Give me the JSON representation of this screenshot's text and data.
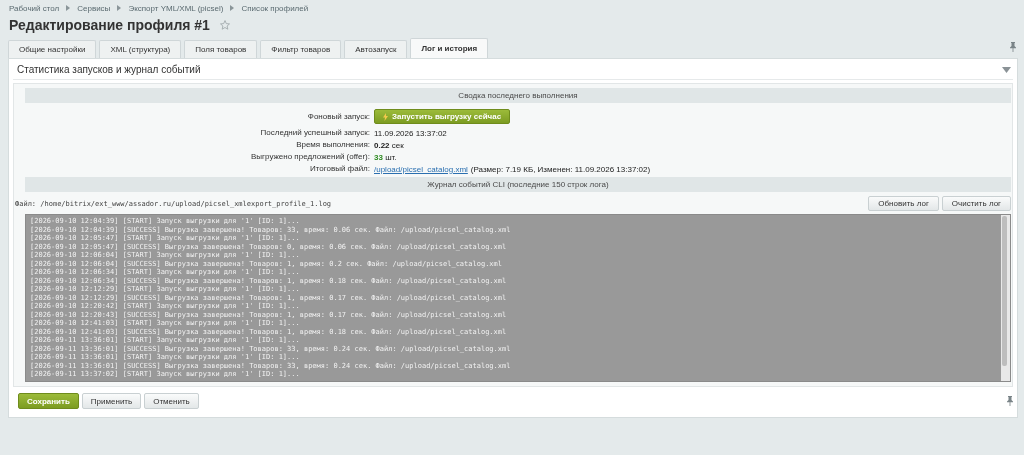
{
  "breadcrumbs": [
    "Рабочий стол",
    "Сервисы",
    "Экспорт YML/XML (picsel)",
    "Список профилей"
  ],
  "title": "Редактирование профиля #1",
  "tabs": [
    {
      "label": "Общие настройки",
      "selected": false
    },
    {
      "label": "XML (структура)",
      "selected": false
    },
    {
      "label": "Поля товаров",
      "selected": false
    },
    {
      "label": "Фильтр товаров",
      "selected": false
    },
    {
      "label": "Автозапуск",
      "selected": false
    },
    {
      "label": "Лог и история",
      "selected": true
    }
  ],
  "section_title": "Статистика запусков и журнал событий",
  "summary": {
    "heading": "Сводка последнего выполнения",
    "run_label": "Фоновый запуск:",
    "run_button": "Запустить выгрузку сейчас",
    "rows": [
      {
        "kind": "bold",
        "label": "Последний успешный запуск:",
        "value": "11.09.2026 13:37:02"
      },
      {
        "kind": "bold",
        "label": "Время выполнения:",
        "value": "0.22",
        "unit": "сек"
      },
      {
        "kind": "count",
        "label": "Выгружено предложений (offer):",
        "value": "33",
        "unit": "шт."
      },
      {
        "kind": "file",
        "label": "Итоговый файл:",
        "value": "/upload/picsel_catalog.xml",
        "unit": "(Размер: 7.19 КБ, Изменен: 11.09.2026 13:37:02)"
      }
    ]
  },
  "log": {
    "heading": "Журнал событий CLI (последние 150 строк лога)",
    "file": "Файл: /home/bitrix/ext_www/assador.ru/upload/picsel_xmlexport_profile_1.log",
    "buttons": [
      "Обновить лог",
      "Очистить лог"
    ],
    "lines": [
      "[2026-09-10 12:04:39] [START] Запуск выгрузки для '1' [ID: 1]...",
      "[2026-09-10 12:04:39] [SUCCESS] Выгрузка завершена! Товаров: 33, время: 0.06 сек. Файл: /upload/picsel_catalog.xml",
      "[2026-09-10 12:05:47] [START] Запуск выгрузки для '1' [ID: 1]...",
      "[2026-09-10 12:05:47] [SUCCESS] Выгрузка завершена! Товаров: 0, время: 0.06 сек. Файл: /upload/picsel_catalog.xml",
      "[2026-09-10 12:06:04] [START] Запуск выгрузки для '1' [ID: 1]...",
      "[2026-09-10 12:06:04] [SUCCESS] Выгрузка завершена! Товаров: 1, время: 0.2 сек. Файл: /upload/picsel_catalog.xml",
      "[2026-09-10 12:06:34] [START] Запуск выгрузки для '1' [ID: 1]...",
      "[2026-09-10 12:06:34] [SUCCESS] Выгрузка завершена! Товаров: 1, время: 0.18 сек. Файл: /upload/picsel_catalog.xml",
      "[2026-09-10 12:12:29] [START] Запуск выгрузки для '1' [ID: 1]...",
      "[2026-09-10 12:12:29] [SUCCESS] Выгрузка завершена! Товаров: 1, время: 0.17 сек. Файл: /upload/picsel_catalog.xml",
      "[2026-09-10 12:20:42] [START] Запуск выгрузки для '1' [ID: 1]...",
      "[2026-09-10 12:20:43] [SUCCESS] Выгрузка завершена! Товаров: 1, время: 0.17 сек. Файл: /upload/picsel_catalog.xml",
      "[2026-09-10 12:41:03] [START] Запуск выгрузки для '1' [ID: 1]...",
      "[2026-09-10 12:41:03] [SUCCESS] Выгрузка завершена! Товаров: 1, время: 0.18 сек. Файл: /upload/picsel_catalog.xml",
      "[2026-09-11 13:36:01] [START] Запуск выгрузки для '1' [ID: 1]...",
      "[2026-09-11 13:36:01] [SUCCESS] Выгрузка завершена! Товаров: 33, время: 0.24 сек. Файл: /upload/picsel_catalog.xml",
      "[2026-09-11 13:36:01] [START] Запуск выгрузки для '1' [ID: 1]...",
      "[2026-09-11 13:36:01] [SUCCESS] Выгрузка завершена! Товаров: 33, время: 0.24 сек. Файл: /upload/picsel_catalog.xml",
      "[2026-09-11 13:37:02] [START] Запуск выгрузки для '1' [ID: 1]..."
    ]
  },
  "footer_buttons": [
    {
      "label": "Сохранить",
      "kind": "primary"
    },
    {
      "label": "Применить",
      "kind": "plain"
    },
    {
      "label": "Отменить",
      "kind": "plain"
    }
  ]
}
